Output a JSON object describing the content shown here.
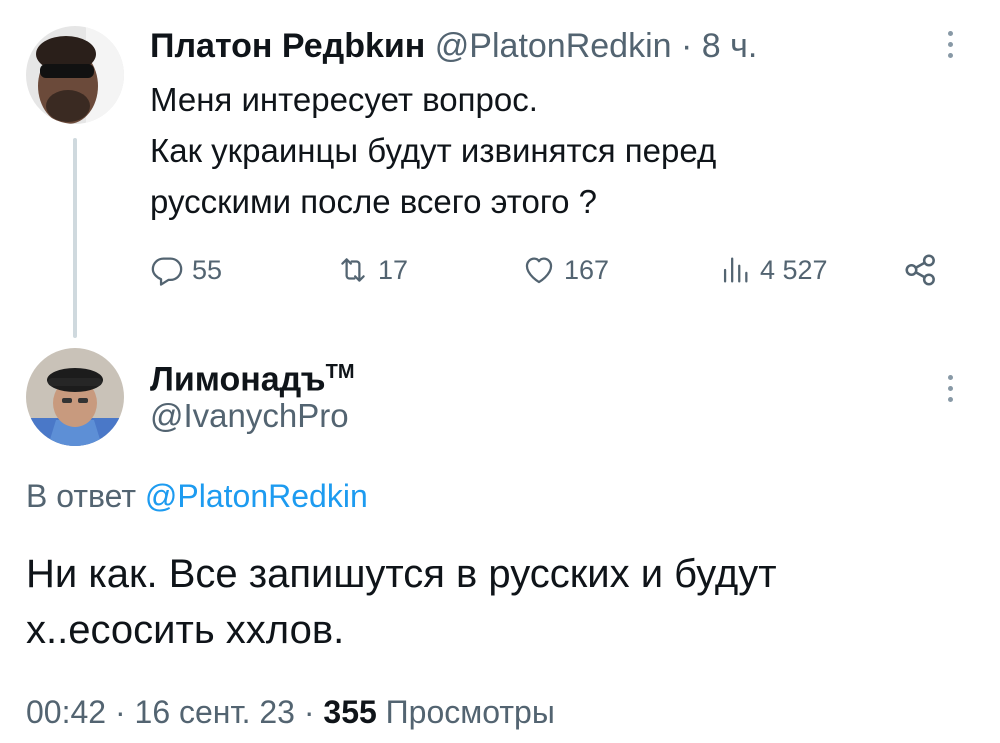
{
  "parent_tweet": {
    "display_name": "Платон Редbkин",
    "handle": "@PlatonRedkin",
    "separator": "·",
    "time": "8 ч.",
    "text_lines": [
      "Меня интересует вопрос.",
      "Как украинцы будут извинятся перед",
      "русскими после всего этого ?"
    ],
    "actions": {
      "replies": "55",
      "retweets": "17",
      "likes": "167",
      "views": "4 527"
    },
    "icons": {
      "reply": "reply-icon",
      "retweet": "retweet-icon",
      "like": "heart-icon",
      "views": "views-icon",
      "share": "share-icon",
      "more": "more-icon"
    }
  },
  "reply_tweet": {
    "display_name": "Лимонадъ",
    "name_suffix": "TM",
    "handle": "@IvanychPro",
    "replying_to_prefix": "В ответ",
    "replying_to_handle": "@PlatonRedkin",
    "text_lines": [
      "Ни как. Все запишутся в русских и будут",
      "х..есосить ххлов."
    ],
    "time": "00:42",
    "separator": "·",
    "date": "16 сент. 23",
    "views_count": "355",
    "views_label": "Просмотры"
  },
  "colors": {
    "text_primary": "#0f1419",
    "text_secondary": "#536471",
    "link": "#1d9bf0",
    "thread_line": "#cfd9de"
  }
}
